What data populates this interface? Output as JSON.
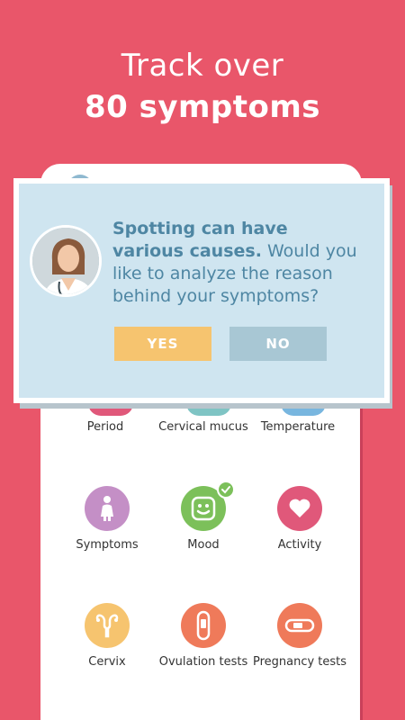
{
  "headline": {
    "line1": "Track over",
    "line2": "80 symptoms"
  },
  "dialog": {
    "text_bold": "Spotting can have various causes.",
    "text_rest": " Would you like to analyze the reason behind your symptoms?",
    "yes_label": "YES",
    "no_label": "NO"
  },
  "row1": [
    {
      "label": "Period"
    },
    {
      "label": "Cervical mucus"
    },
    {
      "label": "Temperature"
    }
  ],
  "row2": [
    {
      "label": "Symptoms",
      "color": "#c48fc6",
      "icon": "person-icon"
    },
    {
      "label": "Mood",
      "color": "#7cc05a",
      "icon": "smiley-icon",
      "checked": true
    },
    {
      "label": "Activity",
      "color": "#e0587a",
      "icon": "heart-icon"
    }
  ],
  "row3": [
    {
      "label": "Cervix",
      "color": "#f6c46f",
      "icon": "uterus-icon"
    },
    {
      "label": "Ovulation tests",
      "color": "#ef7a5a",
      "icon": "ovulation-test-icon"
    },
    {
      "label": "Pregnancy tests",
      "color": "#ef7a5a",
      "icon": "pregnancy-test-icon"
    }
  ],
  "colors": {
    "background": "#e9566a",
    "dialog_bg": "#cfe5f0",
    "dialog_text": "#4e86a3",
    "yes": "#f6c46f",
    "no": "#a8c7d4"
  }
}
